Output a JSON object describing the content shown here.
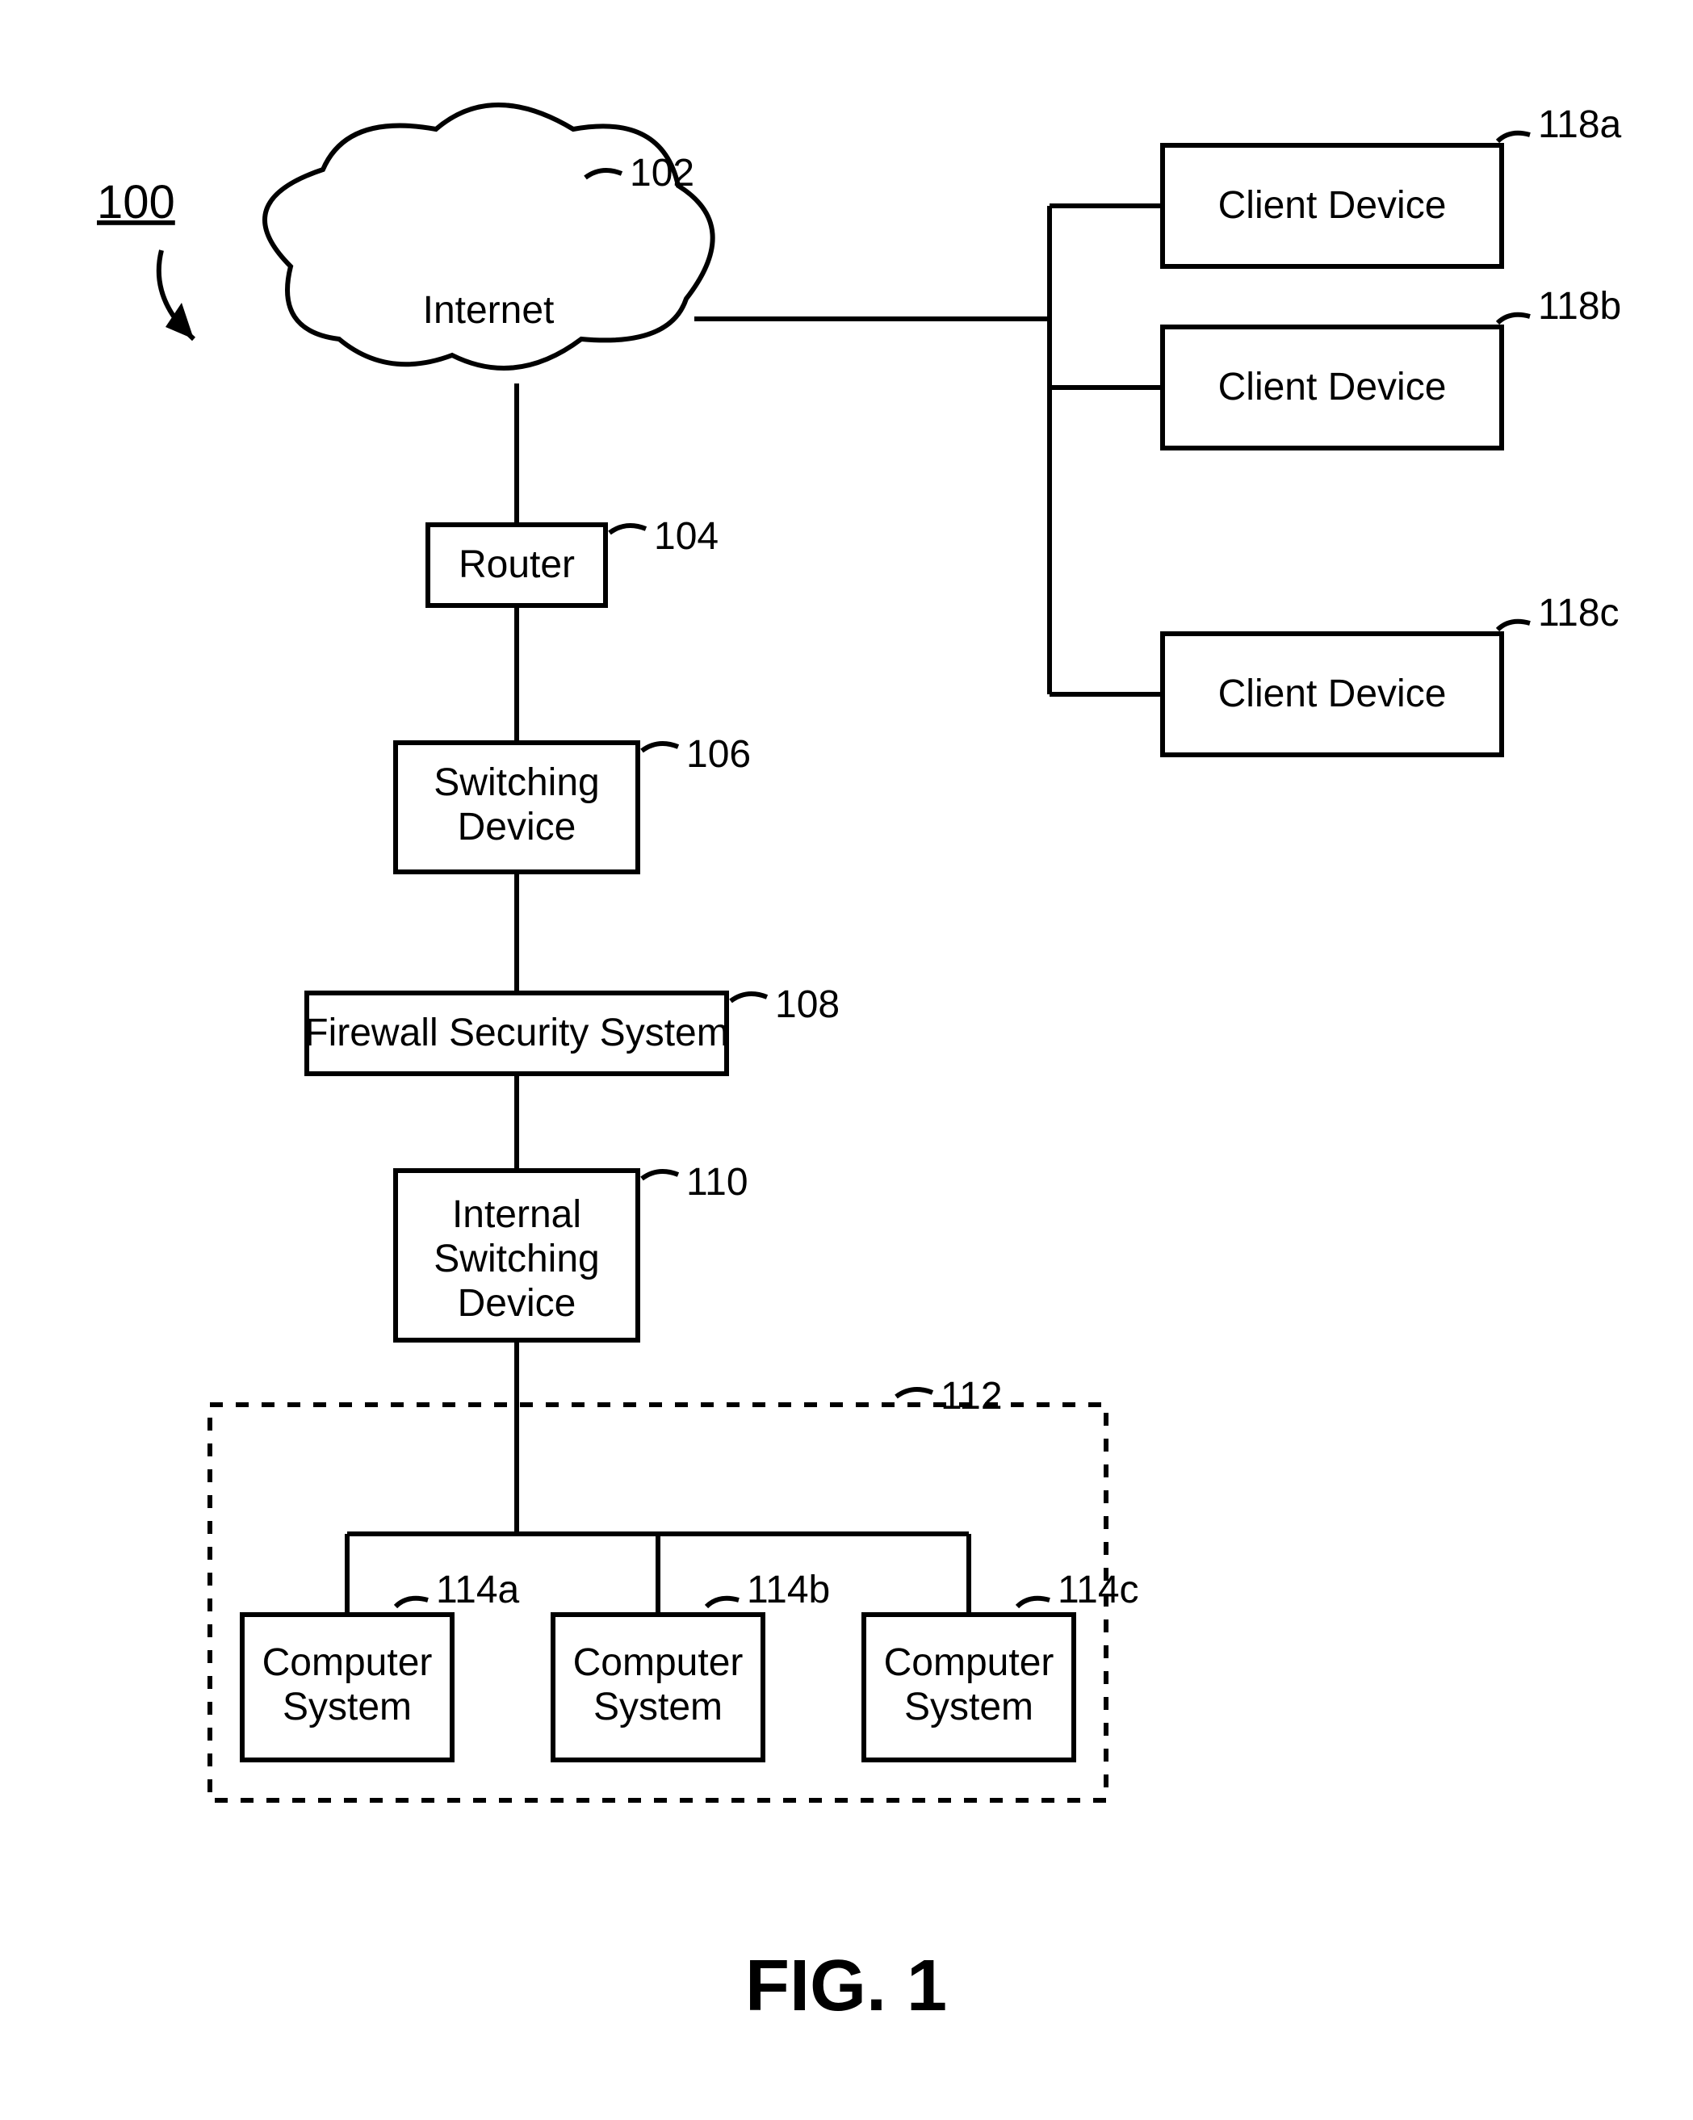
{
  "figure": {
    "ref": "100",
    "caption": "FIG. 1"
  },
  "nodes": {
    "internet": {
      "label": "Internet",
      "ref": "102"
    },
    "router": {
      "label": "Router",
      "ref": "104"
    },
    "switch": {
      "label": "Switching Device",
      "ref": "106"
    },
    "firewall": {
      "label": "Firewall Security System",
      "ref": "108"
    },
    "iswitch": {
      "label": "Internal Switching Device",
      "ref": "110"
    },
    "lan": {
      "ref": "112"
    },
    "cs_a": {
      "label": "Computer System",
      "ref": "114a"
    },
    "cs_b": {
      "label": "Computer System",
      "ref": "114b"
    },
    "cs_c": {
      "label": "Computer System",
      "ref": "114c"
    },
    "cd_a": {
      "label": "Client Device",
      "ref": "118a"
    },
    "cd_b": {
      "label": "Client Device",
      "ref": "118b"
    },
    "cd_c": {
      "label": "Client Device",
      "ref": "118c"
    }
  }
}
